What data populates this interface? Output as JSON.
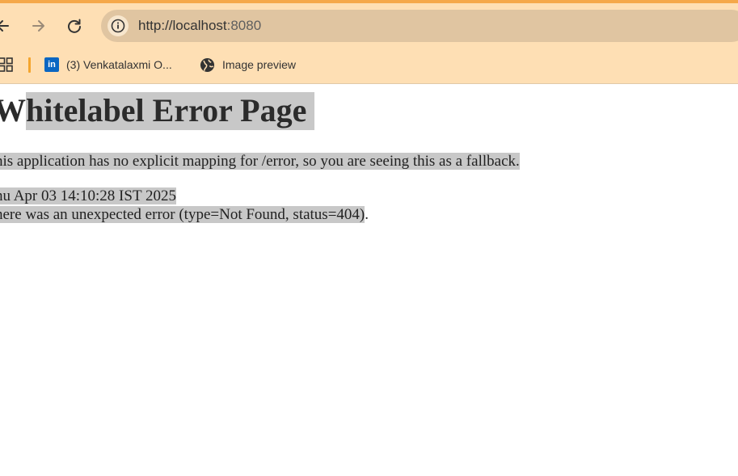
{
  "browser": {
    "address_url": "http://localhost",
    "address_port": ":8080",
    "bookmarks": [
      {
        "label": "(3) Venkatalaxmi O...",
        "icon": "linkedin-icon"
      },
      {
        "label": "Image preview",
        "icon": "globe-icon"
      }
    ],
    "accent_color": "#f5a84a",
    "chrome_color": "#fedfb4"
  },
  "page": {
    "heading_first": "W",
    "heading_rest": "hitelabel Error Page",
    "message": "his application has no explicit mapping for /error, so you are seeing this as a fallback.",
    "timestamp": "hu Apr 03 14:10:28 IST 2025",
    "error_text": "here was an unexpected error (type=Not Found, status=404)",
    "error_trailing": "."
  }
}
